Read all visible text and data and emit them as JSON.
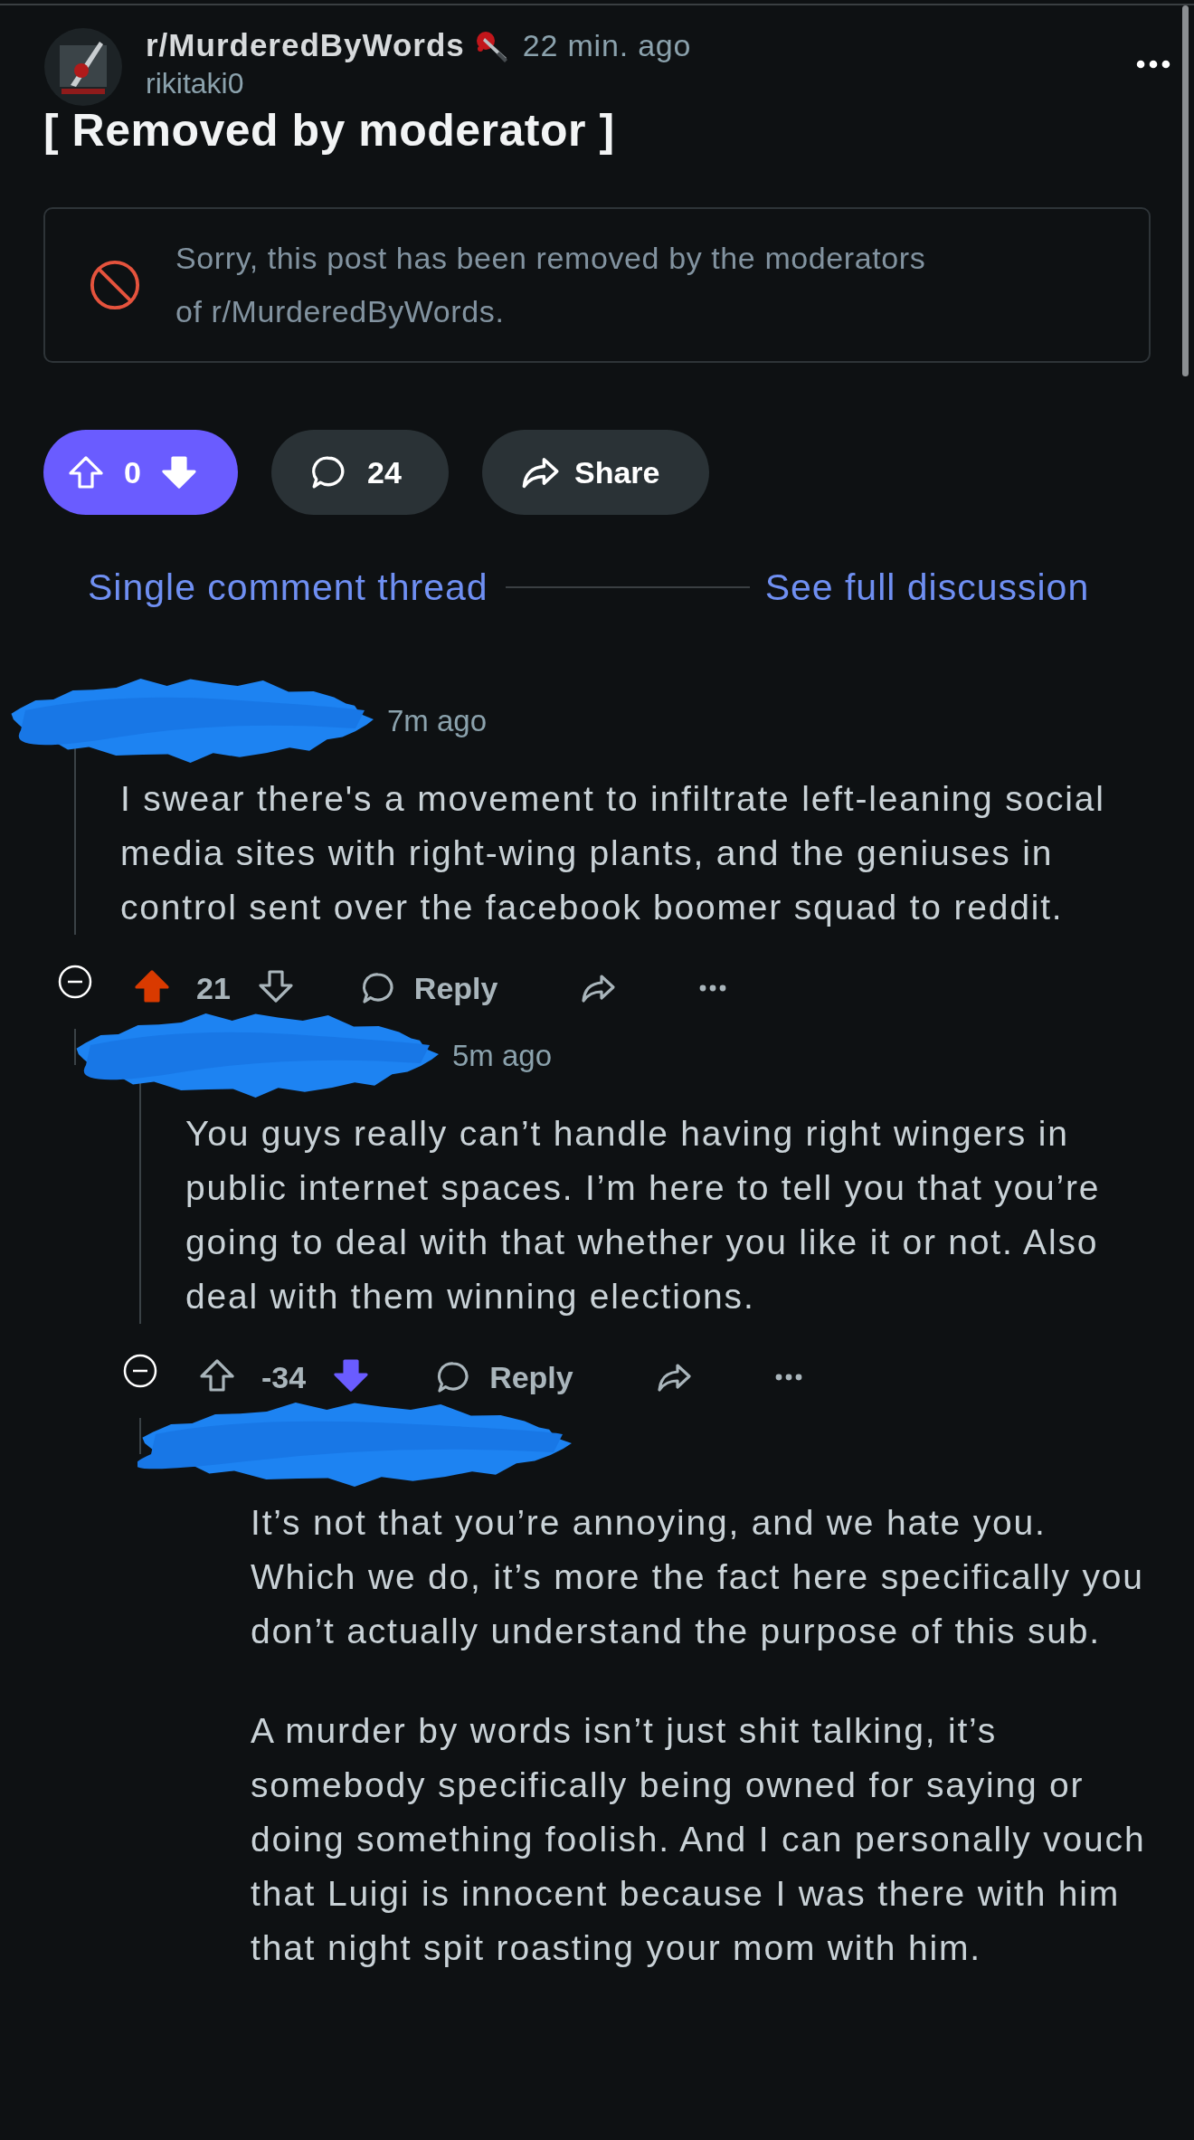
{
  "post": {
    "subreddit": "r/MurderedByWords",
    "posted": "22 min. ago",
    "author": "rikitaki0",
    "title": "[ Removed by moderator ]",
    "notice": "Sorry, this post has been removed by the moderators of r/MurderedByWords.",
    "upvoted": false,
    "downvoted": true,
    "score": "0",
    "comments_count": "24",
    "share": "Share"
  },
  "thread_nav": {
    "single": "Single comment thread",
    "full": "See full discussion"
  },
  "comments": [
    {
      "redacted": true,
      "time": "7m ago",
      "body": [
        "I swear there's a movement to infiltrate left-leaning social media sites with right-wing plants, and the geniuses in control sent over the facebook boomer squad to reddit."
      ],
      "upvoted": true,
      "downvoted": false,
      "score": "21",
      "reply": "Reply",
      "children": [
        {
          "redacted": true,
          "time": "5m ago",
          "body": [
            "You guys really can’t handle having right wingers in public internet spaces. I’m here to tell you that you’re going to deal with that whether you like it or not. Also deal with them winning elections."
          ],
          "upvoted": false,
          "downvoted": true,
          "score": "-34",
          "reply": "Reply",
          "children": [
            {
              "redacted": true,
              "body": [
                "It’s not that you’re annoying, and we hate you. Which we do, it’s more the fact here specifically you don’t actually understand the purpose of this sub.",
                "A murder by words isn’t just shit talking, it’s somebody specifically being owned for saying or doing something foolish. And I can personally vouch that Luigi is innocent because I was there with him that night spit roasting your mom with him."
              ]
            }
          ]
        }
      ]
    }
  ]
}
